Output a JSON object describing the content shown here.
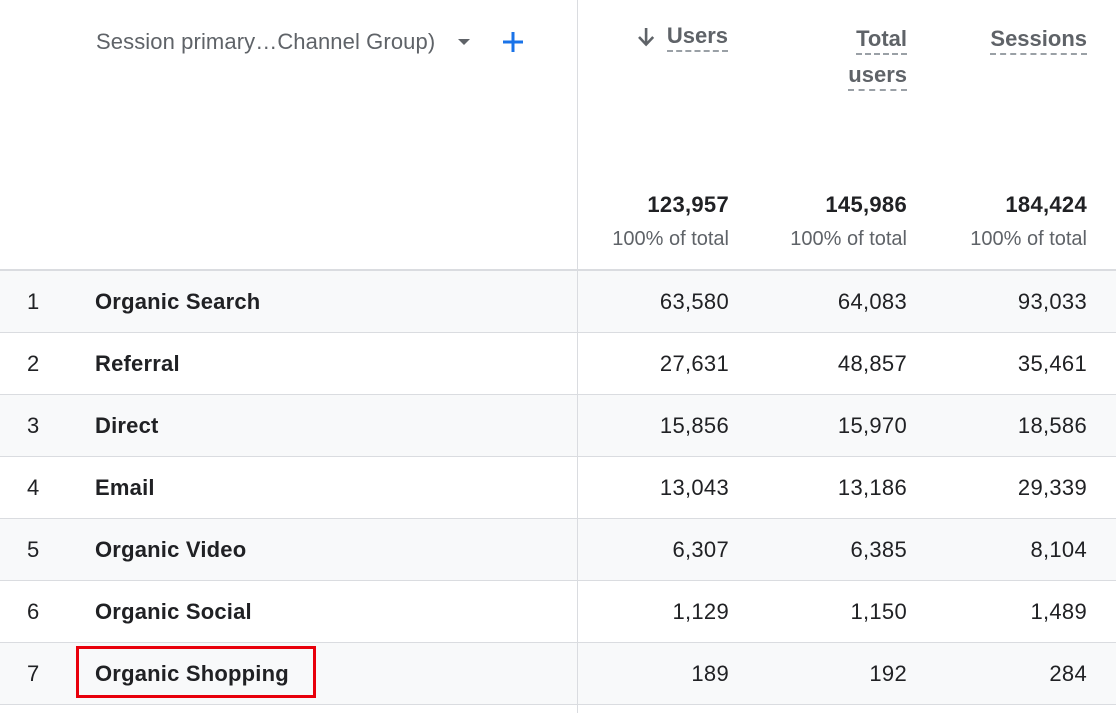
{
  "header": {
    "dimension_label": "Session primary…Channel Group)",
    "dropdown_icon": "arrow-drop-down-icon",
    "add_icon": "plus-icon",
    "sort_icon": "arrow-down-icon",
    "metrics": [
      {
        "label": "Users",
        "sorted": "descending"
      },
      {
        "label_line1": "Total",
        "label_line2": "users"
      },
      {
        "label": "Sessions"
      }
    ]
  },
  "totals": [
    {
      "value": "123,957",
      "pct": "100% of total"
    },
    {
      "value": "145,986",
      "pct": "100% of total"
    },
    {
      "value": "184,424",
      "pct": "100% of total"
    }
  ],
  "rows": [
    {
      "index": "1",
      "channel": "Organic Search",
      "users": "63,580",
      "total_users": "64,083",
      "sessions": "93,033"
    },
    {
      "index": "2",
      "channel": "Referral",
      "users": "27,631",
      "total_users": "48,857",
      "sessions": "35,461"
    },
    {
      "index": "3",
      "channel": "Direct",
      "users": "15,856",
      "total_users": "15,970",
      "sessions": "18,586"
    },
    {
      "index": "4",
      "channel": "Email",
      "users": "13,043",
      "total_users": "13,186",
      "sessions": "29,339"
    },
    {
      "index": "5",
      "channel": "Organic Video",
      "users": "6,307",
      "total_users": "6,385",
      "sessions": "8,104"
    },
    {
      "index": "6",
      "channel": "Organic Social",
      "users": "1,129",
      "total_users": "1,150",
      "sessions": "1,489"
    },
    {
      "index": "7",
      "channel": "Organic Shopping",
      "users": "189",
      "total_users": "192",
      "sessions": "284"
    }
  ],
  "colors": {
    "accent_blue": "#1a73e8",
    "highlight_red": "#e8000b",
    "row_alt": "#f8f9fa",
    "divider": "#dadce0"
  },
  "highlighted_row": "7"
}
